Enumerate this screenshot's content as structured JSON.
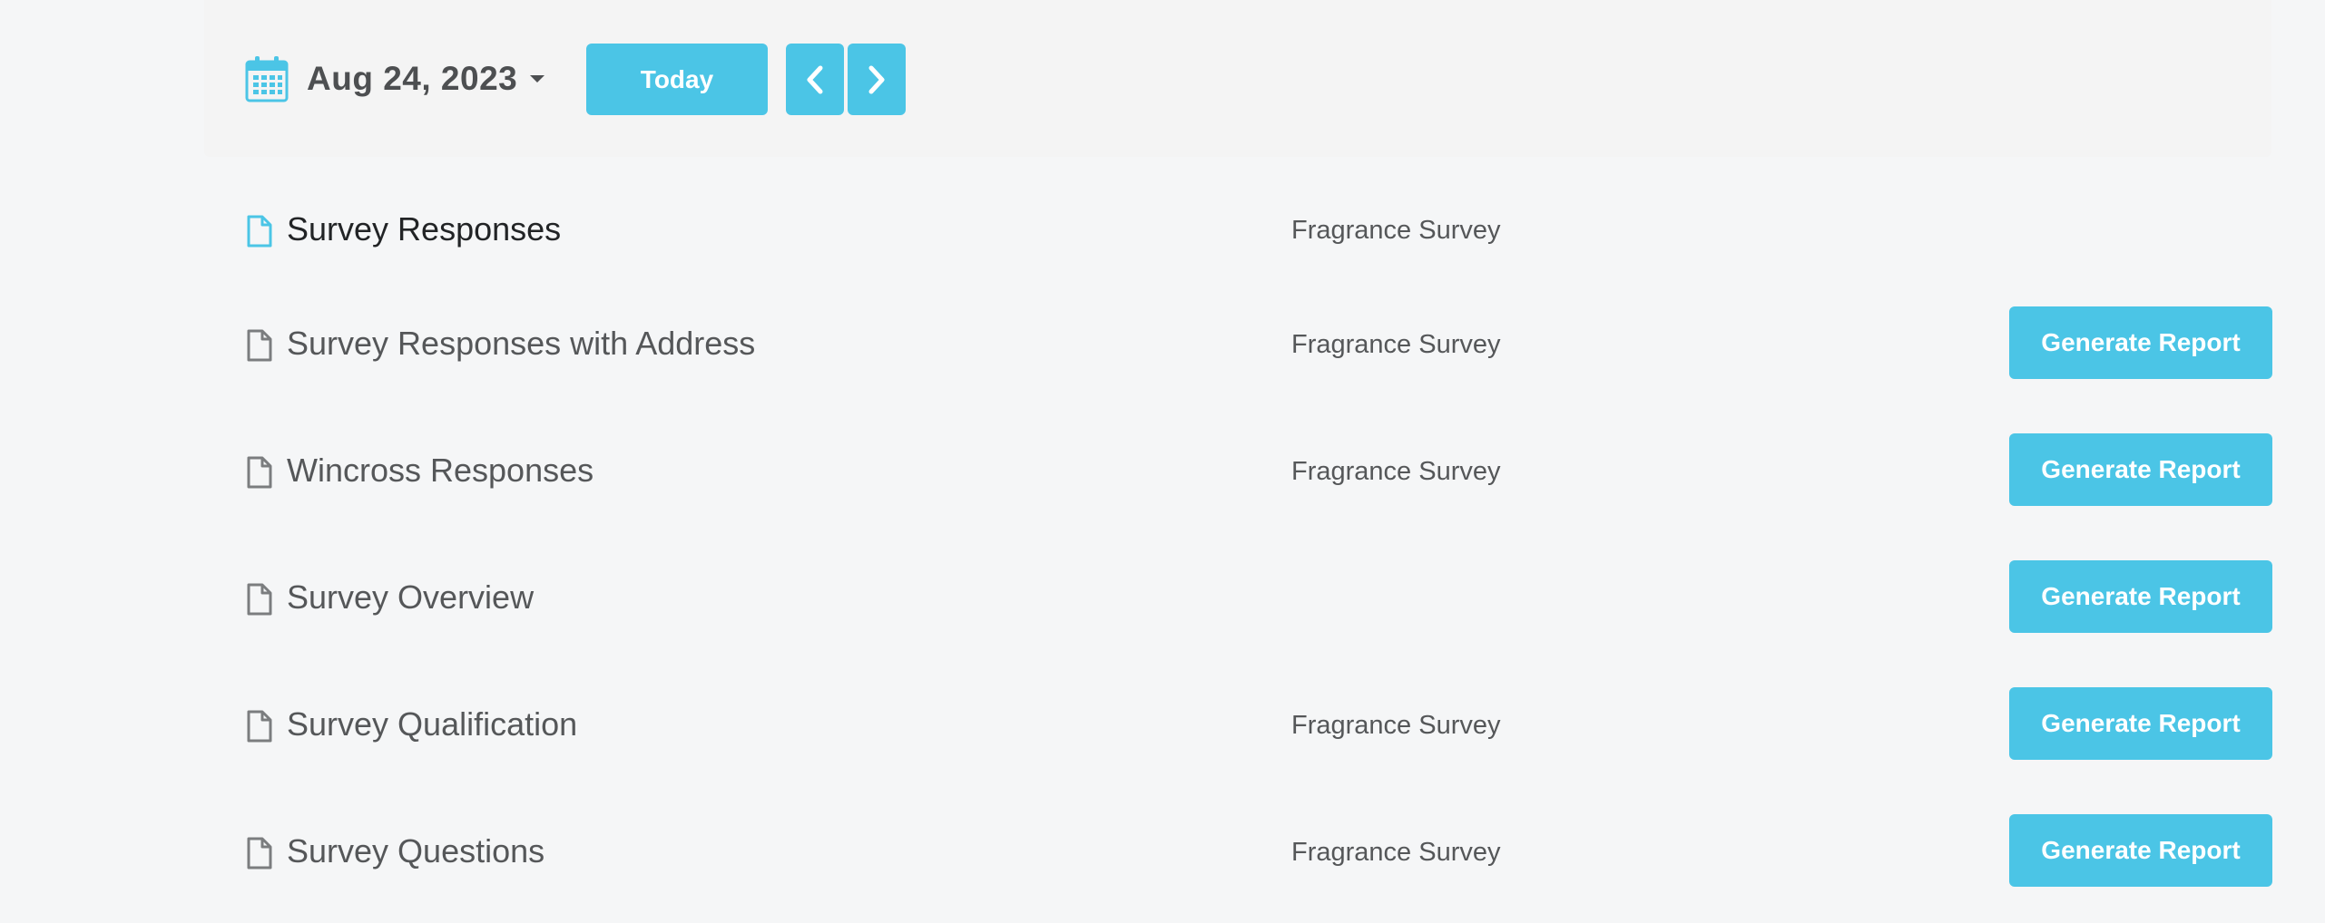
{
  "toolbar": {
    "date_label": "Aug 24, 2023",
    "today_label": "Today",
    "calendar_icon": "calendar-icon",
    "prev_icon": "chevron-left-icon",
    "next_icon": "chevron-right-icon"
  },
  "colors": {
    "accent": "#4bc5e6",
    "text_dark": "#222426",
    "text_muted": "#555759",
    "background": "#f5f6f7"
  },
  "reports": [
    {
      "title": "Survey Responses",
      "survey": "Fragrance Survey",
      "button_label": "",
      "active": true,
      "icon": "document-icon"
    },
    {
      "title": "Survey Responses with Address",
      "survey": "Fragrance Survey",
      "button_label": "Generate Report",
      "active": false,
      "icon": "document-icon"
    },
    {
      "title": "Wincross Responses",
      "survey": "Fragrance Survey",
      "button_label": "Generate Report",
      "active": false,
      "icon": "document-icon"
    },
    {
      "title": "Survey Overview",
      "survey": "",
      "button_label": "Generate Report",
      "active": false,
      "icon": "document-icon"
    },
    {
      "title": "Survey Qualification",
      "survey": "Fragrance Survey",
      "button_label": "Generate Report",
      "active": false,
      "icon": "document-icon"
    },
    {
      "title": "Survey Questions",
      "survey": "Fragrance Survey",
      "button_label": "Generate Report",
      "active": false,
      "icon": "document-icon"
    }
  ]
}
